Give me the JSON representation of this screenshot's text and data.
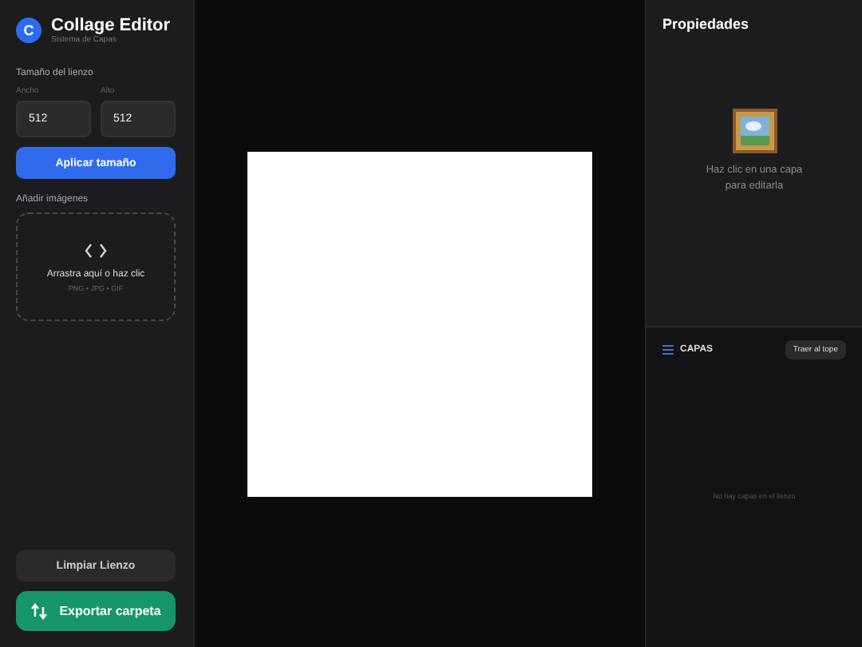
{
  "app": {
    "logo_letter": "C",
    "title": "Collage Editor",
    "subtitle": "Sistema de Capas"
  },
  "canvas_size": {
    "label": "Tamaño del lienzo",
    "fields": [
      {
        "label": "Ancho",
        "value": "512"
      },
      {
        "label": "Alto",
        "value": "512"
      }
    ],
    "apply_button": "Aplicar tamaño"
  },
  "add_images": {
    "label": "Añadir imágenes",
    "drop_title": "Arrastra aquí o haz clic",
    "drop_formats": "PNG • JPG • GIF"
  },
  "buttons": {
    "clear": "Limpiar Lienzo",
    "export": "Exportar carpeta"
  },
  "properties": {
    "title": "Propiedades",
    "empty_text": "Haz clic en una capa para editarla"
  },
  "layers": {
    "title": "CAPAS",
    "bring_front_button": "Traer al tope",
    "empty_text": "No hay capas en el lienzo"
  }
}
